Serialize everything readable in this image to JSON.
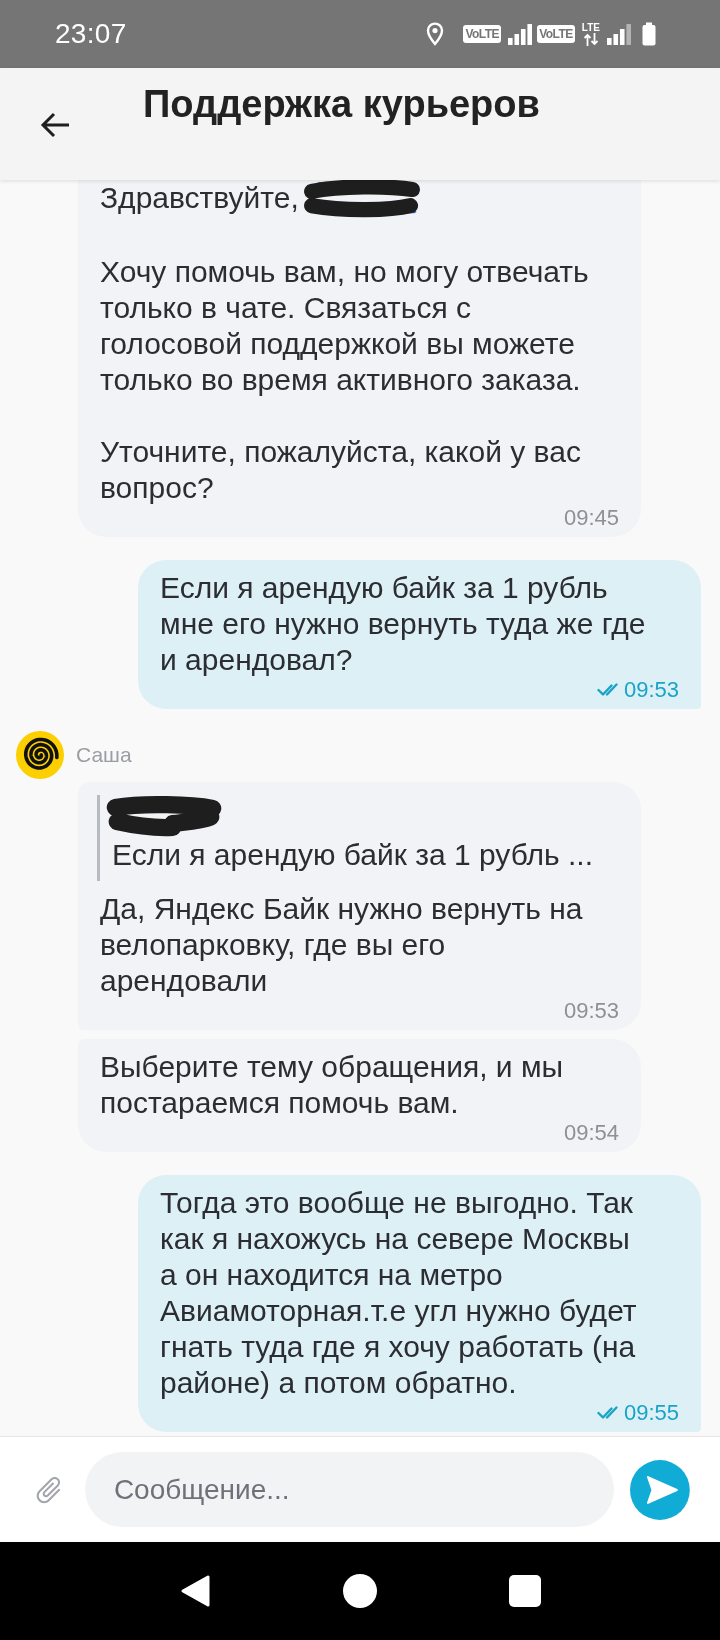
{
  "status_bar": {
    "time": "23:07",
    "sims": [
      {
        "badge": "VoLTE"
      },
      {
        "badge": "VoLTE",
        "data_type": "LTE"
      }
    ]
  },
  "header": {
    "title": "Поддержка курьеров"
  },
  "messages": [
    {
      "kind": "incoming",
      "greeting": "Здравствуйте,",
      "greeting_redacted": true,
      "paragraphs": [
        "Хочу помочь вам, но могу отвечать только в чате. Связаться с голосовой поддержкой вы можете только во время активного заказа.",
        "Уточните, пожалуйста, какой у вас вопрос?"
      ],
      "time": "09:45"
    },
    {
      "kind": "outgoing",
      "paragraphs": [
        "Если я арендую байк за 1 рубль мне его нужно вернуть туда же где и арендовал?"
      ],
      "time": "09:53",
      "read": true
    },
    {
      "kind": "sender",
      "name": "Саша"
    },
    {
      "kind": "incoming",
      "reply": {
        "author_redacted": true,
        "text": "Если я арендую байк за 1 рубль ..."
      },
      "paragraphs": [
        "Да, Яндекс Байк нужно вернуть на велопарковку, где вы его арендовали"
      ],
      "time": "09:53"
    },
    {
      "kind": "incoming",
      "paragraphs": [
        "Выберите тему обращения, и мы постараемся помочь вам."
      ],
      "time": "09:54"
    },
    {
      "kind": "outgoing",
      "paragraphs": [
        "Тогда это вообще не выгодно. Так как я нахожусь на севере Москвы а он находится на метро Авиамоторная.т.е угл нужно будет гнать туда где я хочу работать (на районе) а потом обратно."
      ],
      "time": "09:55",
      "read": true
    }
  ],
  "composer": {
    "placeholder": "Сообщение..."
  }
}
